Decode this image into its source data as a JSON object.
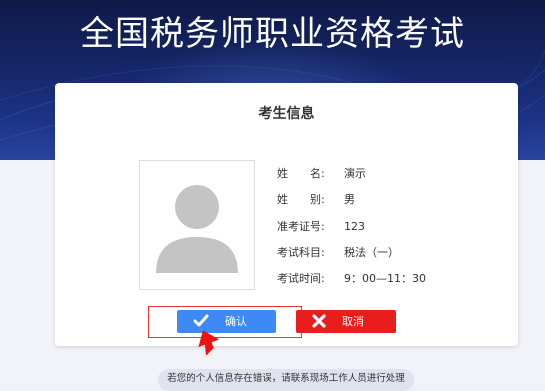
{
  "header": {
    "title": "全国税务师职业资格考试"
  },
  "card": {
    "title": "考生信息",
    "photo_icon": "person-silhouette-icon",
    "fields": [
      {
        "label": "姓　　名:",
        "value": "演示"
      },
      {
        "label": "姓　　别:",
        "value": "男"
      },
      {
        "label": "准考证号:",
        "value": "123"
      },
      {
        "label": "考试科目:",
        "value": "税法（一）"
      },
      {
        "label": "考试时间:",
        "value": "9：00—11：30"
      }
    ]
  },
  "actions": {
    "confirm_label": "确认",
    "confirm_icon": "check-icon",
    "cancel_label": "取消",
    "cancel_icon": "close-icon",
    "pointer_icon": "red-arrow-icon"
  },
  "notice": {
    "text": "若您的个人信息存在错误，请联系现场工作人员进行处理"
  },
  "colors": {
    "banner": "#16276a",
    "confirm": "#3d8af7",
    "cancel": "#ea1d1d",
    "highlight": "#ee3333"
  }
}
